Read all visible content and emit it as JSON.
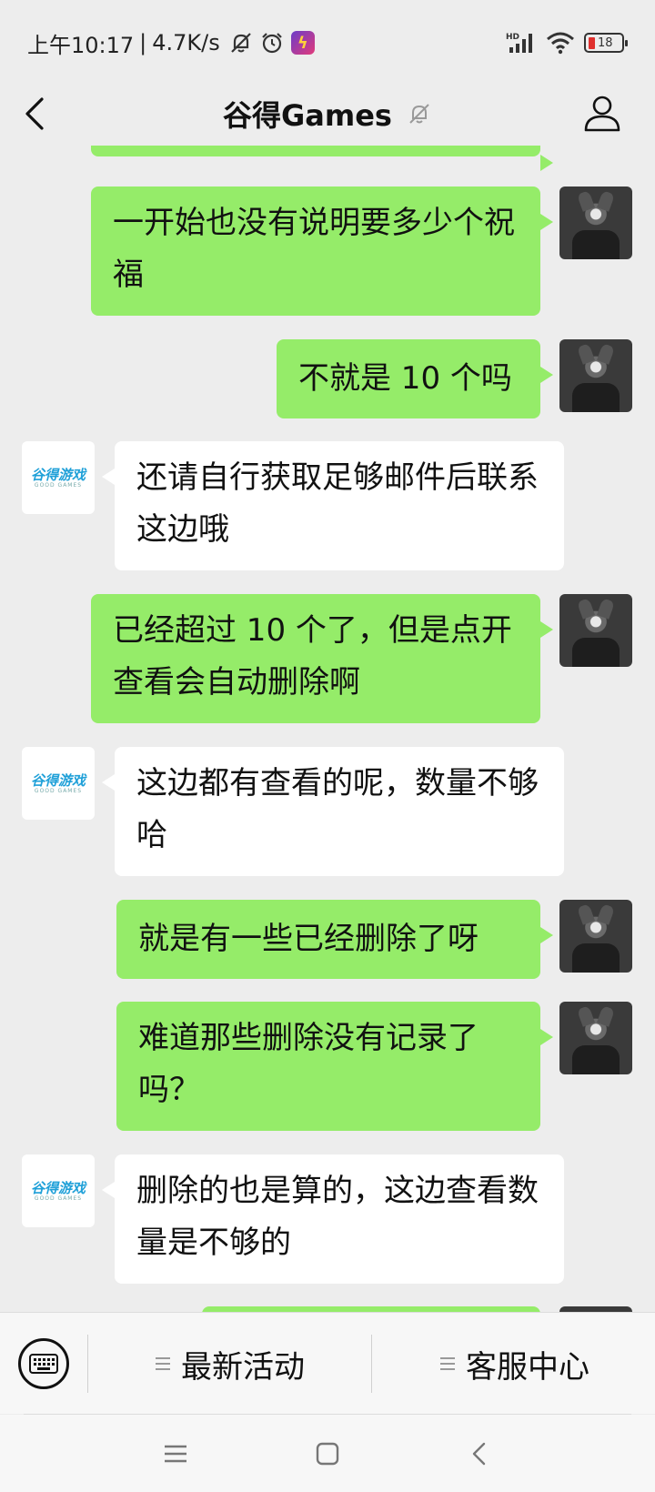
{
  "status_bar": {
    "time": "上午10:17",
    "separator": "|",
    "net_speed": "4.7K/s",
    "signal_label": "HD",
    "battery_level": "18",
    "icons": [
      "bell-mute-icon",
      "alarm-icon",
      "app-badge-icon",
      "signal-icon",
      "wifi-icon",
      "battery-icon"
    ],
    "battery_color": "#e0302e"
  },
  "header": {
    "title": "谷得Games",
    "icons": [
      "back-arrow-icon",
      "bell-mute-icon",
      "profile-icon"
    ]
  },
  "bot": {
    "logo_text": "谷得游戏",
    "logo_sub": "GOOD GAMES",
    "brand_color": "#1fa0d8"
  },
  "messages": [
    {
      "from": "me",
      "text": "一开始也没有说明要多少个祝福"
    },
    {
      "from": "me",
      "text": "不就是 10 个吗"
    },
    {
      "from": "bot",
      "text": "还请自行获取足够邮件后联系这边哦"
    },
    {
      "from": "me",
      "text": "已经超过 10 个了，但是点开查看会自动删除啊"
    },
    {
      "from": "bot",
      "text": "这边都有查看的呢，数量不够哈"
    },
    {
      "from": "me",
      "text": "就是有一些已经删除了呀"
    },
    {
      "from": "me",
      "text": "难道那些删除没有记录了吗？"
    },
    {
      "from": "bot",
      "text": "删除的也是算的，这边查看数量是不够的"
    }
  ],
  "bottom_menu": {
    "keyboard_icon": "keyboard-icon",
    "items": [
      {
        "label": "最新活动",
        "icon": "menu-lines-icon"
      },
      {
        "label": "客服中心",
        "icon": "menu-lines-icon"
      }
    ]
  },
  "nav_bar": {
    "icons": [
      "recents-icon",
      "home-icon",
      "back-icon"
    ]
  },
  "colors": {
    "outgoing_bubble": "#95ec69",
    "incoming_bubble": "#ffffff",
    "background": "#ededed"
  }
}
